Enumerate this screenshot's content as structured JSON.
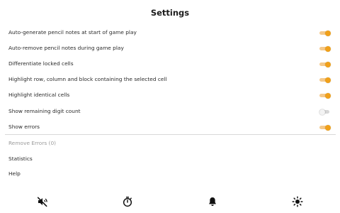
{
  "header": {
    "title": "Settings"
  },
  "settings": [
    {
      "label": "Auto-generate pencil notes at start of game play",
      "enabled": true
    },
    {
      "label": "Auto-remove pencil notes during game play",
      "enabled": true
    },
    {
      "label": "Differentiate locked cells",
      "enabled": true
    },
    {
      "label": "Highlight row, column and block containing the selected cell",
      "enabled": true
    },
    {
      "label": "Highlight identical cells",
      "enabled": true
    },
    {
      "label": "Show remaining digit count",
      "enabled": false
    },
    {
      "label": "Show errors",
      "enabled": true
    }
  ],
  "actions": {
    "remove_errors": "Remove Errors (0)",
    "statistics": "Statistics",
    "help": "Help"
  },
  "bottom_bar": [
    {
      "icon": "speaker-muted-icon"
    },
    {
      "icon": "stopwatch-icon"
    },
    {
      "icon": "bell-icon"
    },
    {
      "icon": "brightness-icon"
    }
  ],
  "colors": {
    "accent": "#f0a01a",
    "accent_track": "#f5c98a",
    "off_track": "#d6d6d6",
    "text": "#2a2a2a",
    "disabled_text": "#9a9a9a"
  }
}
